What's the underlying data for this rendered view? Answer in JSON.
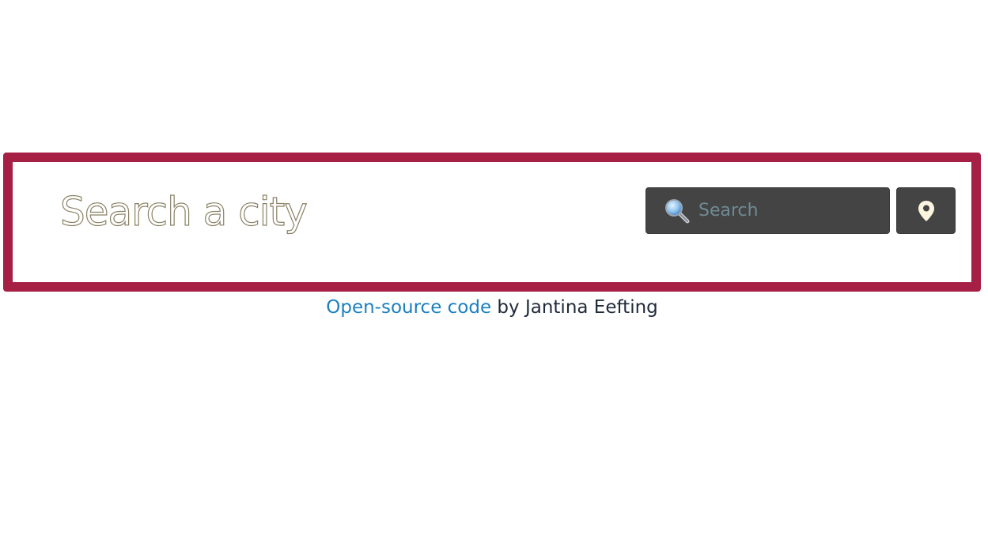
{
  "header": {
    "title": "Search a city"
  },
  "search": {
    "placeholder": "Search",
    "value": "",
    "icon": "magnifier-icon"
  },
  "location_button": {
    "icon": "map-pin-icon"
  },
  "footer": {
    "link_text": "Open-source code",
    "suffix": " by Jantina Eefting"
  },
  "colors": {
    "card_border": "#a61f45",
    "control_bg": "#444444",
    "link": "#1a7fc0"
  }
}
